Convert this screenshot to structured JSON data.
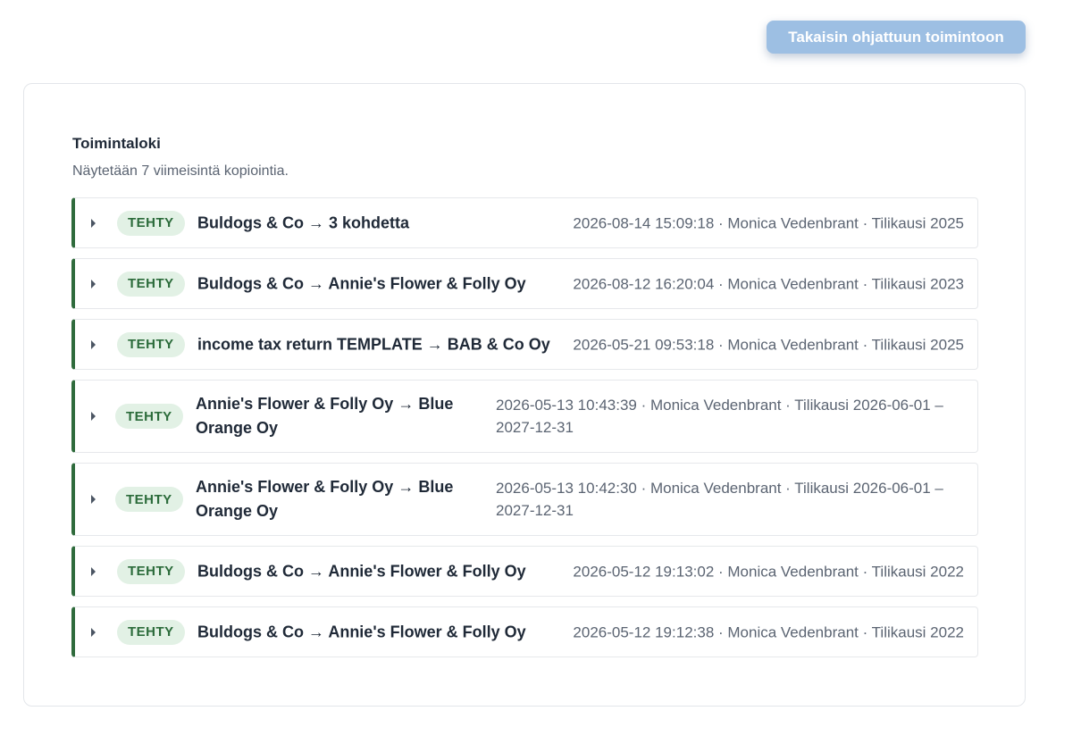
{
  "header": {
    "back_button_label": "Takaisin ohjattuun toimintoon"
  },
  "log": {
    "title": "Toimintaloki",
    "subtitle": "Näytetään 7 viimeisintä kopiointia.",
    "entries": [
      {
        "status": "TEHTY",
        "title": "Buldogs & Co → 3 kohdetta",
        "meta": "2026-08-14 15:09:18 · Monica Vedenbrant · Tilikausi 2025"
      },
      {
        "status": "TEHTY",
        "title": "Buldogs & Co → Annie's Flower & Folly Oy",
        "meta": "2026-08-12 16:20:04 · Monica Vedenbrant · Tilikausi 2023"
      },
      {
        "status": "TEHTY",
        "title": "income tax return TEMPLATE → BAB & Co Oy",
        "meta": "2026-05-21 09:53:18 · Monica Vedenbrant · Tilikausi 2025"
      },
      {
        "status": "TEHTY",
        "title": "Annie's Flower & Folly Oy → Blue Orange Oy",
        "meta": "2026-05-13 10:43:39 · Monica Vedenbrant · Tilikausi 2026-06-01 – 2027-12-31"
      },
      {
        "status": "TEHTY",
        "title": "Annie's Flower & Folly Oy → Blue Orange Oy",
        "meta": "2026-05-13 10:42:30 · Monica Vedenbrant · Tilikausi 2026-06-01 – 2027-12-31"
      },
      {
        "status": "TEHTY",
        "title": "Buldogs & Co → Annie's Flower & Folly Oy",
        "meta": "2026-05-12 19:13:02 · Monica Vedenbrant · Tilikausi 2022"
      },
      {
        "status": "TEHTY",
        "title": "Buldogs & Co → Annie's Flower & Folly Oy",
        "meta": "2026-05-12 19:12:38 · Monica Vedenbrant · Tilikausi 2022"
      }
    ]
  },
  "colors": {
    "accent_button": "#9dbfe3",
    "row_border_accent": "#2f6b3c",
    "badge_bg": "#e2f1e5",
    "badge_text": "#2b6b3a"
  },
  "icons": {
    "expand": "caret-right-icon"
  }
}
